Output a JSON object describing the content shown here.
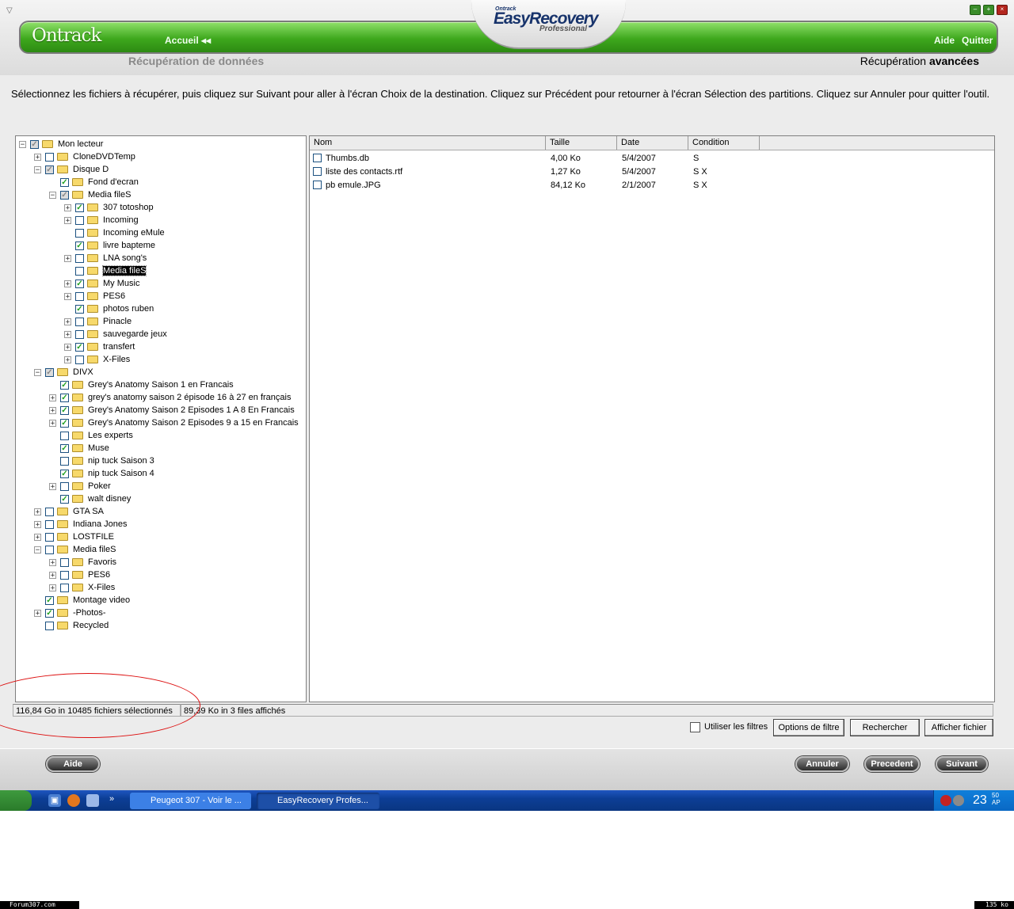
{
  "window": {
    "sys_menu_glyph": "▽"
  },
  "header": {
    "brand": "Ontrack",
    "product_small": "Ontrack",
    "product": "EasyRecovery",
    "edition": "Professional",
    "home_label": "Accueil",
    "home_glyph": "◂◂",
    "help_label": "Aide",
    "quit_label": "Quitter",
    "subtitle_left": "Récupération de données",
    "subtitle_right_prefix": "Récupération ",
    "subtitle_right_bold": "avancées"
  },
  "instructions": "Sélectionnez les fichiers à récupérer, puis cliquez sur Suivant pour aller à l'écran Choix de la destination. Cliquez sur Précédent pour retourner à l'écran Sélection des partitions. Cliquez sur Annuler pour quitter l'outil.",
  "tree": [
    {
      "label": "Mon lecteur",
      "depth": 0,
      "expander": "minus",
      "check": "partial"
    },
    {
      "label": "CloneDVDTemp",
      "depth": 1,
      "expander": "plus",
      "check": "none"
    },
    {
      "label": "Disque D",
      "depth": 1,
      "expander": "minus",
      "check": "partial"
    },
    {
      "label": "Fond d'ecran",
      "depth": 2,
      "expander": "",
      "check": "checked"
    },
    {
      "label": "Media fileS",
      "depth": 2,
      "expander": "minus",
      "check": "partial"
    },
    {
      "label": "307 totoshop",
      "depth": 3,
      "expander": "plus",
      "check": "checked"
    },
    {
      "label": "Incoming",
      "depth": 3,
      "expander": "plus",
      "check": "none"
    },
    {
      "label": "Incoming eMule",
      "depth": 3,
      "expander": "",
      "check": "none"
    },
    {
      "label": "livre bapteme",
      "depth": 3,
      "expander": "",
      "check": "checked"
    },
    {
      "label": "LNA song's",
      "depth": 3,
      "expander": "plus",
      "check": "none"
    },
    {
      "label": "Media fileS",
      "depth": 3,
      "expander": "",
      "check": "none",
      "selected": true
    },
    {
      "label": "My Music",
      "depth": 3,
      "expander": "plus",
      "check": "checked"
    },
    {
      "label": "PES6",
      "depth": 3,
      "expander": "plus",
      "check": "none"
    },
    {
      "label": "photos ruben",
      "depth": 3,
      "expander": "",
      "check": "checked"
    },
    {
      "label": "Pinacle",
      "depth": 3,
      "expander": "plus",
      "check": "none"
    },
    {
      "label": "sauvegarde jeux",
      "depth": 3,
      "expander": "plus",
      "check": "none"
    },
    {
      "label": "transfert",
      "depth": 3,
      "expander": "plus",
      "check": "checked"
    },
    {
      "label": "X-Files",
      "depth": 3,
      "expander": "plus",
      "check": "none"
    },
    {
      "label": "DIVX",
      "depth": 1,
      "expander": "minus",
      "check": "partial"
    },
    {
      "label": "Grey's Anatomy Saison 1 en Francais",
      "depth": 2,
      "expander": "",
      "check": "checked"
    },
    {
      "label": "grey's anatomy saison 2 épisode 16 à 27 en français",
      "depth": 2,
      "expander": "plus",
      "check": "checked"
    },
    {
      "label": "Grey's Anatomy Saison 2 Episodes 1 A 8 En Francais",
      "depth": 2,
      "expander": "plus",
      "check": "checked"
    },
    {
      "label": "Grey's Anatomy Saison 2 Episodes 9 a 15 en Francais",
      "depth": 2,
      "expander": "plus",
      "check": "checked"
    },
    {
      "label": "Les experts",
      "depth": 2,
      "expander": "",
      "check": "none"
    },
    {
      "label": "Muse",
      "depth": 2,
      "expander": "",
      "check": "checked"
    },
    {
      "label": "nip tuck Saison 3",
      "depth": 2,
      "expander": "",
      "check": "none"
    },
    {
      "label": "nip tuck Saison 4",
      "depth": 2,
      "expander": "",
      "check": "checked"
    },
    {
      "label": "Poker",
      "depth": 2,
      "expander": "plus",
      "check": "none"
    },
    {
      "label": "walt disney",
      "depth": 2,
      "expander": "",
      "check": "checked"
    },
    {
      "label": "GTA SA",
      "depth": 1,
      "expander": "plus",
      "check": "none"
    },
    {
      "label": "Indiana Jones",
      "depth": 1,
      "expander": "plus",
      "check": "none"
    },
    {
      "label": "LOSTFILE",
      "depth": 1,
      "expander": "plus",
      "check": "none"
    },
    {
      "label": "Media fileS",
      "depth": 1,
      "expander": "minus",
      "check": "none"
    },
    {
      "label": "Favoris",
      "depth": 2,
      "expander": "plus",
      "check": "none"
    },
    {
      "label": "PES6",
      "depth": 2,
      "expander": "plus",
      "check": "none"
    },
    {
      "label": "X-Files",
      "depth": 2,
      "expander": "plus",
      "check": "none"
    },
    {
      "label": "Montage video",
      "depth": 1,
      "expander": "",
      "check": "checked"
    },
    {
      "label": "-Photos-",
      "depth": 1,
      "expander": "plus",
      "check": "checked"
    },
    {
      "label": "Recycled",
      "depth": 1,
      "expander": "",
      "check": "none"
    }
  ],
  "list": {
    "columns": [
      "Nom",
      "Taille",
      "Date",
      "Condition"
    ],
    "rows": [
      {
        "name": "Thumbs.db",
        "size": "4,00 Ko",
        "date": "5/4/2007",
        "condition": "S"
      },
      {
        "name": "liste des contacts.rtf",
        "size": "1,27 Ko",
        "date": "5/4/2007",
        "condition": "S X"
      },
      {
        "name": "pb emule.JPG",
        "size": "84,12 Ko",
        "date": "2/1/2007",
        "condition": "S X"
      }
    ]
  },
  "status": {
    "selected": "116,84 Go in 10485 fichiers sélectionnés",
    "shown": "89,39 Ko in 3 files affichés"
  },
  "filters": {
    "use_filters_label": "Utiliser les filtres",
    "options_button": "Options de filtre",
    "search_button": "Rechercher",
    "show_file_button": "Afficher fichier"
  },
  "footer": {
    "help": "Aide",
    "cancel": "Annuler",
    "previous": "Precedent",
    "next": "Suivant"
  },
  "taskbar": {
    "more_glyph": "»",
    "task1": "Peugeot 307 - Voir le ...",
    "task2": "EasyRecovery Profes...",
    "time": "23",
    "time_min": "50",
    "ampm": "AP"
  },
  "overlay": {
    "left_tag": "Forum307.com",
    "right_tag": "135 ko"
  },
  "colors": {
    "accent_green": "#3ea81d",
    "ellipse_red": "#dd1111",
    "taskbar_blue": "#0c3e96"
  }
}
